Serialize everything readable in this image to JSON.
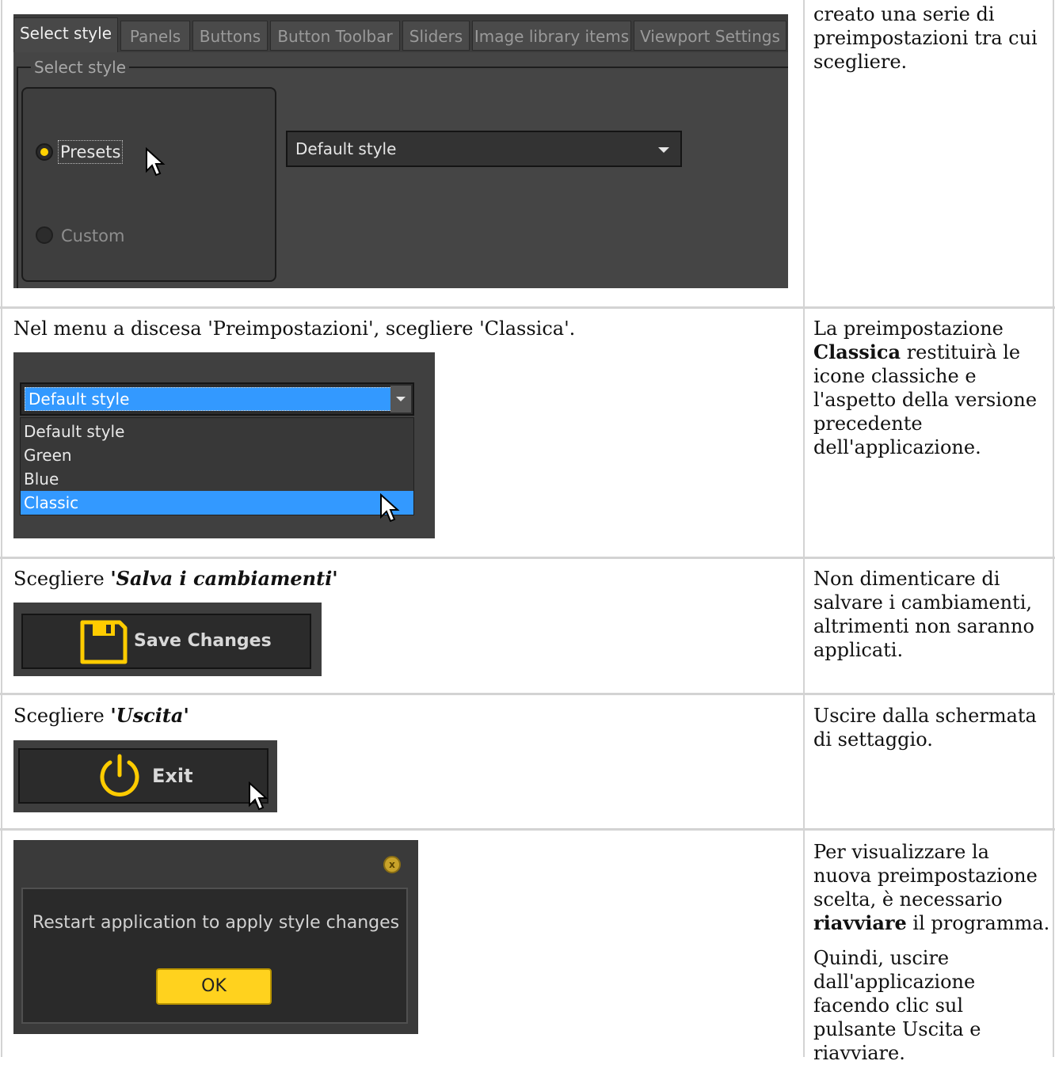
{
  "row1": {
    "tabs": [
      "Select style",
      "Panels",
      "Buttons",
      "Button Toolbar",
      "Sliders",
      "Image library items",
      "Viewport Settings"
    ],
    "group_legend": "Select style",
    "radio_presets": "Presets",
    "radio_custom": "Custom",
    "dropdown_value": "Default style",
    "description": "creato una serie di preimpostazioni tra cui scegliere."
  },
  "row2": {
    "instruction": "Nel menu a discesa 'Preimpostazioni', scegliere 'Classica'.",
    "dropdown_value": "Default style",
    "options": [
      "Default style",
      "Green",
      "Blue",
      "Classic"
    ],
    "description_prefix": "La preimpostazione ",
    "description_bold": "Classica",
    "description_suffix": " restituirà le icone classiche e l'aspetto della versione precedente dell'applicazione."
  },
  "row3": {
    "instruction_prefix": "Scegliere ",
    "instruction_emph": "'Salva i cambiamenti'",
    "button_label": "Save Changes",
    "description": "Non dimenticare di salvare i cambiamenti, altrimenti non saranno applicati."
  },
  "row4": {
    "instruction_prefix": "Scegliere ",
    "instruction_emph": "'Uscita'",
    "button_label": "Exit",
    "description": "Uscire dalla schermata di settaggio."
  },
  "row5": {
    "dialog_message": "Restart application to apply style changes",
    "ok_label": "OK",
    "close_glyph": "x",
    "description_prefix": "Per visualizzare la nuova preimpostazione scelta, è necessario ",
    "description_bold": "riavviare",
    "description_suffix": " il programma.",
    "description2": "Quindi, uscire dall'applicazione facendo clic sul pulsante Uscita e riavviare."
  },
  "colors": {
    "accent_yellow": "#ffd21e",
    "highlight_blue": "#3399ff",
    "panel_dark": "#404040"
  }
}
